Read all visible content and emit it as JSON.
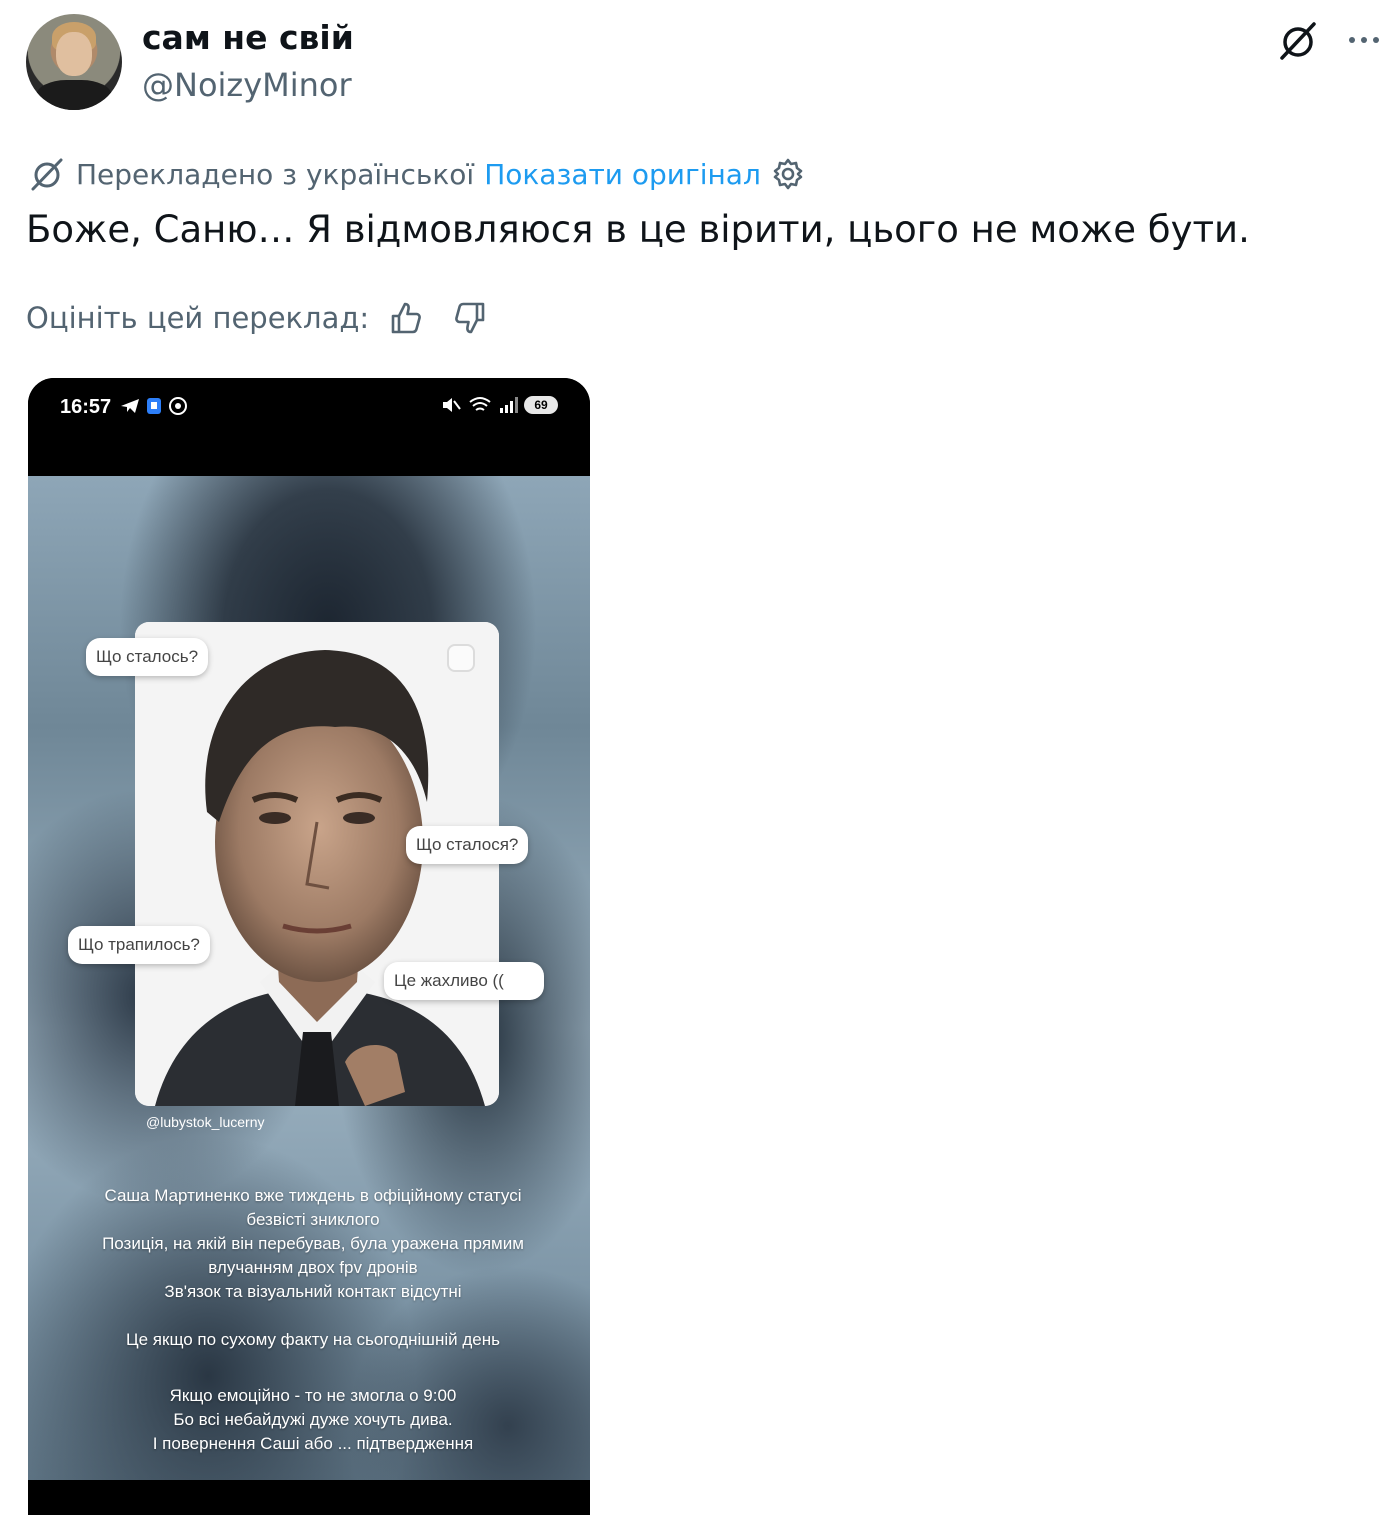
{
  "author": {
    "display_name": "сам не свій",
    "handle": "@NoizyMinor"
  },
  "translation": {
    "label": "Перекладено з української",
    "show_original": "Показати оригінал"
  },
  "tweet": {
    "text": "Боже, Саню… Я відмовляюся в це вірити, цього не може бути."
  },
  "rating": {
    "label": "Оцініть цей переклад:"
  },
  "media": {
    "status_bar": {
      "time": "16:57",
      "battery": "69"
    },
    "stickers": {
      "s1": "Що сталось?",
      "s2": "Що сталося?",
      "s3": "Що трапилось?",
      "s4": "Це жахливо (("
    },
    "tag": "@lubystok_lucerny",
    "paragraph1": [
      "Саша Мартиненко  вже тиждень в офіційному статусі",
      "безвісті зниклого",
      "Позиція, на якій він перебував, була уражена прямим",
      "влучанням двох  fpv дронів",
      "Зв'язок та візуальний контакт відсутні"
    ],
    "paragraph2": "Це якщо по сухому факту на сьогоднішній день",
    "paragraph3": [
      "Якщо емоційно - то не змогла о 9:00",
      "Бо всі небайдужі дуже хочуть дива.",
      "І повернення Саші або ... підтвердження"
    ]
  }
}
